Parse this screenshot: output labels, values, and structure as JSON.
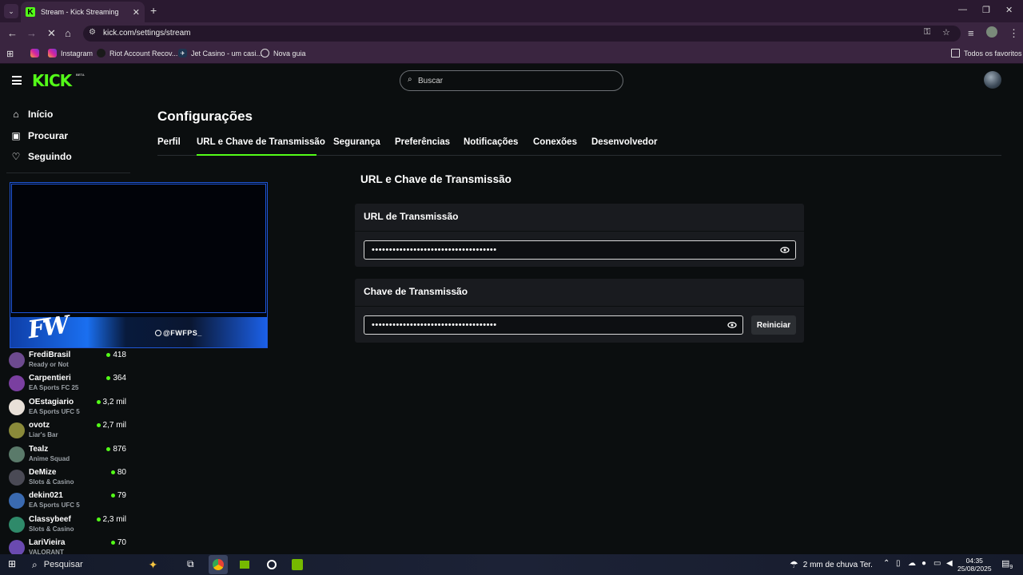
{
  "browser": {
    "tab_title": "Stream - Kick Streaming",
    "url": "kick.com/settings/stream",
    "bookmarks": [
      {
        "label": "Instagram"
      },
      {
        "label": "Riot Account Recov..."
      },
      {
        "label": "Jet Casino - um casi..."
      },
      {
        "label": "Nova guia"
      }
    ],
    "all_bookmarks": "Todos os favoritos"
  },
  "header": {
    "logo": "KICK",
    "logo_badge": "BETA",
    "search_placeholder": "Buscar"
  },
  "sidebar": {
    "nav": [
      {
        "label": "Início",
        "icon": "home-icon"
      },
      {
        "label": "Procurar",
        "icon": "browse-icon"
      },
      {
        "label": "Seguindo",
        "icon": "heart-icon"
      }
    ],
    "channels": [
      {
        "name": "FrediBrasil",
        "category": "Ready or Not",
        "viewers": "418",
        "color": "#6d4a8f"
      },
      {
        "name": "Carpentieri",
        "category": "EA Sports FC 25",
        "viewers": "364",
        "color": "#7a3fa0"
      },
      {
        "name": "OEstagiario",
        "category": "EA Sports UFC 5",
        "viewers": "3,2 mil",
        "color": "#e8e0d8"
      },
      {
        "name": "ovotz",
        "category": "Liar's Bar",
        "viewers": "2,7 mil",
        "color": "#8a8a3a"
      },
      {
        "name": "Tealz",
        "category": "Anime Squad",
        "viewers": "876",
        "color": "#5a7a6a"
      },
      {
        "name": "DeMize",
        "category": "Slots & Casino",
        "viewers": "80",
        "color": "#4a4a55"
      },
      {
        "name": "dekin021",
        "category": "EA Sports UFC 5",
        "viewers": "79",
        "color": "#3a6ab0"
      },
      {
        "name": "Classybeef",
        "category": "Slots & Casino",
        "viewers": "2,3 mil",
        "color": "#2f8a6a"
      },
      {
        "name": "LariVieira",
        "category": "VALORANT",
        "viewers": "70",
        "color": "#6a4ab0"
      }
    ]
  },
  "overlay": {
    "handle": "@FWFPS_",
    "logo_text": "FW"
  },
  "settings": {
    "title": "Configurações",
    "tabs": [
      {
        "label": "Perfil"
      },
      {
        "label": "URL e Chave de Transmissão"
      },
      {
        "label": "Segurança"
      },
      {
        "label": "Preferências"
      },
      {
        "label": "Notificações"
      },
      {
        "label": "Conexões"
      },
      {
        "label": "Desenvolvedor"
      }
    ],
    "active_tab": "URL e Chave de Transmissão",
    "section_title": "URL e Chave de Transmissão",
    "url_card": {
      "title": "URL de Transmissão",
      "masked_value": "••••••••••••••••••••••••••••••••••••"
    },
    "key_card": {
      "title": "Chave de Transmissão",
      "masked_value": "••••••••••••••••••••••••••••••••••••",
      "reset_label": "Reiniciar"
    }
  },
  "taskbar": {
    "search_label": "Pesquisar",
    "weather": "2 mm de chuva Ter.",
    "time": "04:35",
    "date": "25/08/2025",
    "notifications": "9"
  },
  "colors": {
    "accent": "#53fc18",
    "card_bg": "#191b1f",
    "page_bg": "#0b0e0f"
  }
}
